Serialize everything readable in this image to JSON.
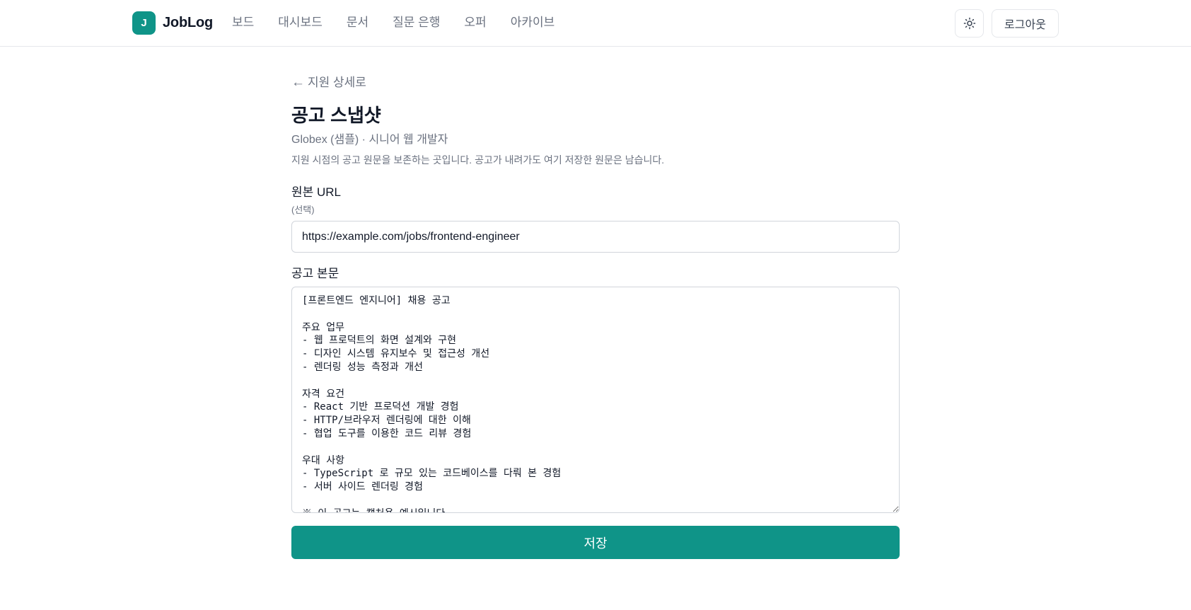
{
  "brand": {
    "logo_letter": "J",
    "name": "JobLog",
    "accent_color": "#0f9488"
  },
  "nav": {
    "items": [
      {
        "label": "보드"
      },
      {
        "label": "대시보드"
      },
      {
        "label": "문서"
      },
      {
        "label": "질문 은행"
      },
      {
        "label": "오퍼"
      },
      {
        "label": "아카이브"
      }
    ]
  },
  "header": {
    "theme_icon": "sun-icon",
    "logout_label": "로그아웃"
  },
  "page": {
    "back_arrow": "←",
    "back_label": "지원 상세로",
    "title": "공고 스냅샷",
    "subtitle": "Globex (샘플) · 시니어 웹 개발자",
    "description": "지원 시점의 공고 원문을 보존하는 곳입니다. 공고가 내려가도 여기 저장한 원문은 남습니다."
  },
  "form": {
    "url_label": "원본 URL",
    "url_hint": "(선택)",
    "url_value": "https://example.com/jobs/frontend-engineer",
    "body_label": "공고 본문",
    "body_value": "[프론트엔드 엔지니어] 채용 공고\n\n주요 업무\n- 웹 프로덕트의 화면 설계와 구현\n- 디자인 시스템 유지보수 및 접근성 개선\n- 렌더링 성능 측정과 개선\n\n자격 요건\n- React 기반 프로덕션 개발 경험\n- HTTP/브라우저 렌더링에 대한 이해\n- 협업 도구를 이용한 코드 리뷰 경험\n\n우대 사항\n- TypeScript 로 규모 있는 코드베이스를 다뤄 본 경험\n- 서버 사이드 렌더링 경험\n\n※ 이 공고는 캡처용 예시입니다.",
    "save_label": "저장"
  }
}
